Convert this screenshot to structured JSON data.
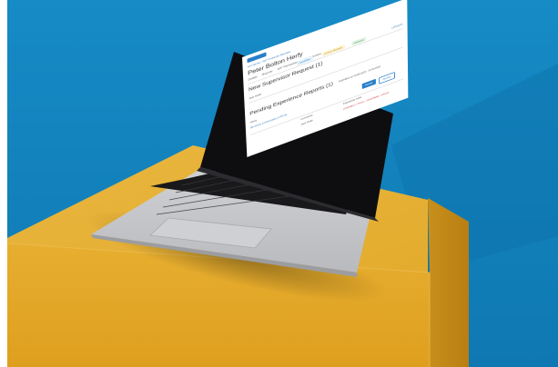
{
  "photo": {
    "colors": {
      "wall": "#1a86c0",
      "wall_dark": "#0d6ea6",
      "block_top": "#e7b33a",
      "block_front": "#e4ad2c",
      "block_side": "#c88f18",
      "laptop_body": "#c9cacd",
      "keyboard": "#1b1b1d",
      "bezel": "#0e0e10"
    }
  },
  "screen": {
    "breadcrumb": "All Clients  ›  AIP Financial Member",
    "title": "Peter Bolton Herfy",
    "tabs": [
      "Details",
      "Reports",
      "AIP Transactions",
      "My Licenses"
    ],
    "badges": [
      "Candidate",
      "Licence Manager",
      "Licensed"
    ],
    "update_link": "UPDATE",
    "new_supervisor": {
      "heading": "New Supervisor Request (1)",
      "row_label": "Jack Smith"
    },
    "pending": {
      "heading": "Pending Experience Reports (1)",
      "meta": "Submitted on 02/01/2020 · 01/31/2020",
      "col_name": "Name",
      "col_comments": "Comments",
      "col_status": "Experience Units",
      "name_link": "Bill Morris & Associates (LPRCA)",
      "comment": "Jack Smith",
      "status_red": "Unverified: 0 Hours · Unverifiable: 0 Hours",
      "approve_label": "Accept",
      "decline_label": "Decline"
    }
  }
}
